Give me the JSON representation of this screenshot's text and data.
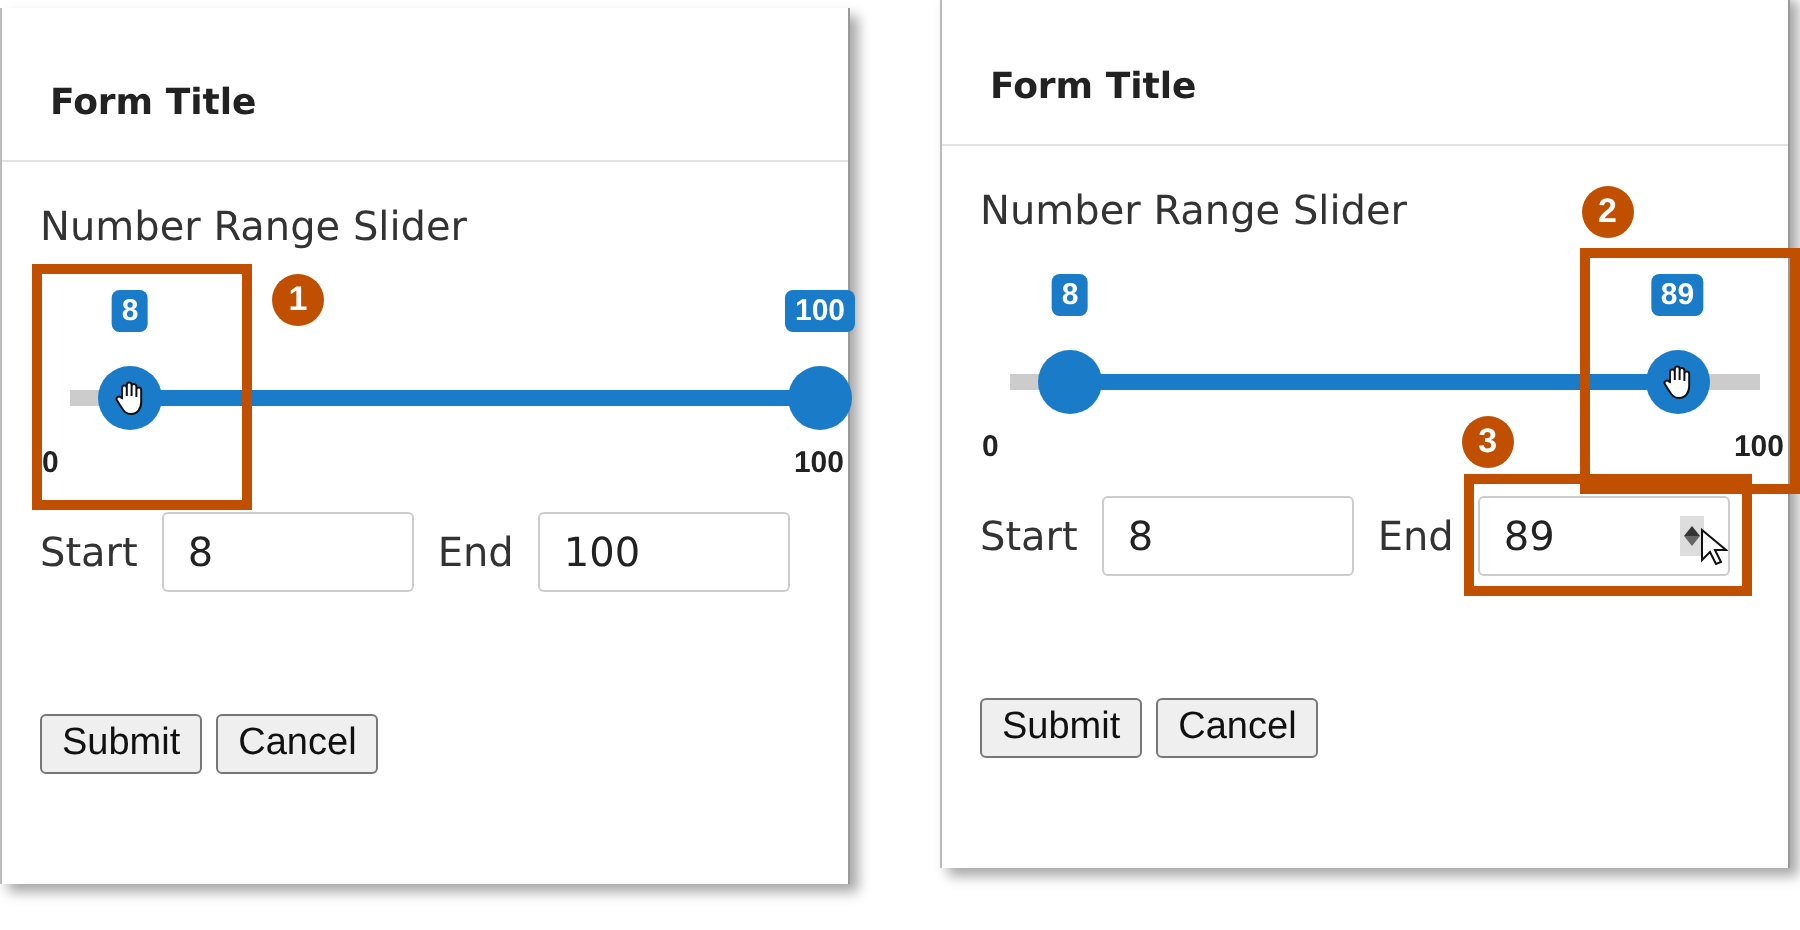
{
  "panels": [
    {
      "title": "Form Title",
      "slider_label": "Number Range Slider",
      "slider": {
        "min_label": "0",
        "max_label": "100",
        "thumbs": [
          {
            "badge": "8",
            "level": 0.08,
            "grabbed": true,
            "callout": "1"
          },
          {
            "badge": "100",
            "level": 1,
            "grabbed": false
          }
        ]
      },
      "fields": [
        {
          "label": "Start",
          "value": "8",
          "hovered": false
        },
        {
          "label": "End",
          "value": "100",
          "hovered": false
        }
      ],
      "buttons": [
        "Submit",
        "Cancel"
      ]
    },
    {
      "title": "Form Title",
      "slider_label": "Number Range Slider",
      "slider": {
        "min_label": "0",
        "max_label": "100",
        "thumbs": [
          {
            "badge": "8",
            "level": 0.08,
            "grabbed": false
          },
          {
            "badge": "89",
            "level": 0.89,
            "grabbed": true,
            "callout": "2"
          }
        ]
      },
      "fields": [
        {
          "label": "Start",
          "value": "8",
          "hovered": false
        },
        {
          "label": "End",
          "value": "89",
          "hovered": true,
          "callout": "3"
        }
      ],
      "buttons": [
        "Submit",
        "Cancel"
      ]
    }
  ]
}
